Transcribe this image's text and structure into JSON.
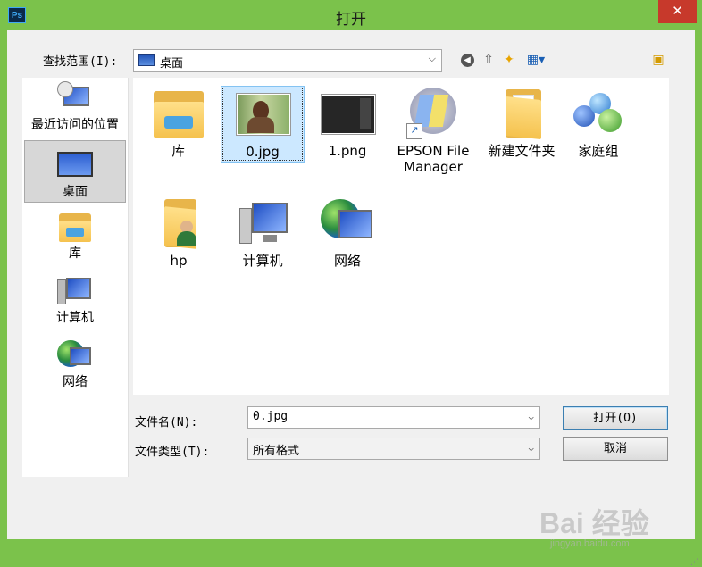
{
  "window": {
    "title": "打开",
    "app_icon_text": "Ps",
    "close_glyph": "✕",
    "accent_color": "#7bc24b",
    "close_color": "#c7392b"
  },
  "toolbar": {
    "lookin_label": "查找范围(I):",
    "lookin_value": "桌面",
    "dropdown_glyph": "⌵",
    "back_glyph": "◀",
    "up_glyph": "⇧",
    "new_folder_glyph": "✦",
    "view_glyph": "▦▾",
    "right_icon_glyph": "▣"
  },
  "places": [
    {
      "label": "最近访问的位置",
      "icon": "recent-places-icon"
    },
    {
      "label": "桌面",
      "icon": "desktop-icon",
      "selected": true
    },
    {
      "label": "库",
      "icon": "library-icon"
    },
    {
      "label": "计算机",
      "icon": "computer-icon"
    },
    {
      "label": "网络",
      "icon": "network-icon"
    }
  ],
  "files": [
    {
      "label": "库",
      "icon": "library-folder-icon"
    },
    {
      "label": "0.jpg",
      "icon": "image-thumbnail-icon",
      "selected": true
    },
    {
      "label": "1.png",
      "icon": "screenshot-thumbnail-icon"
    },
    {
      "label": "EPSON File Manager",
      "icon": "epson-shortcut-icon"
    },
    {
      "label": "新建文件夹",
      "icon": "folder-icon"
    },
    {
      "label": "家庭组",
      "icon": "homegroup-icon"
    },
    {
      "label": "hp",
      "icon": "user-folder-icon"
    },
    {
      "label": "计算机",
      "icon": "computer-icon"
    },
    {
      "label": "网络",
      "icon": "network-icon"
    }
  ],
  "form": {
    "filename_label": "文件名(N):",
    "filename_value": "0.jpg",
    "filetype_label": "文件类型(T):",
    "filetype_value": "所有格式",
    "open_button": "打开(O)",
    "cancel_button": "取消"
  },
  "watermark": {
    "logo": "Bai 经验",
    "sub": "jingyan.baidu.com"
  }
}
